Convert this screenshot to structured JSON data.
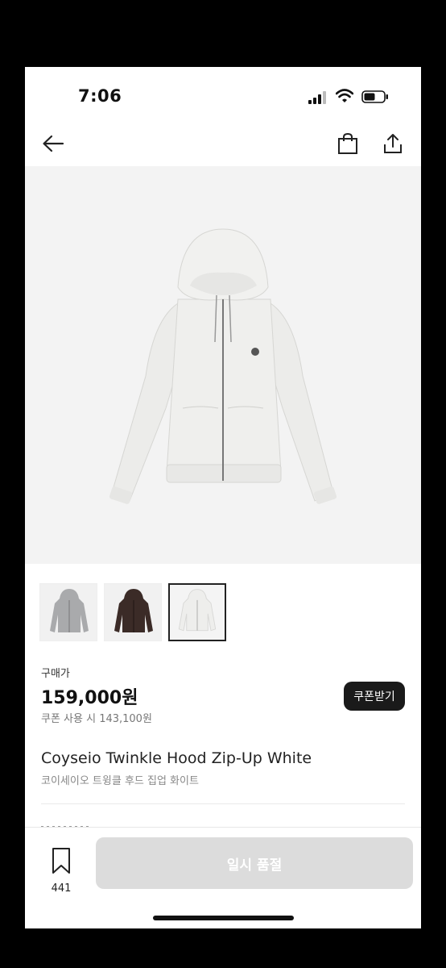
{
  "status_bar": {
    "time": "7:06"
  },
  "product": {
    "price_label": "구매가",
    "price": "159,000원",
    "coupon_price": "쿠폰 사용 시 143,100원",
    "coupon_button": "쿠폰받기",
    "name_en": "Coyseio Twinkle Hood Zip-Up White",
    "name_ko": "코이세이오 트윙클 후드 집업 화이트"
  },
  "thumbnails": [
    {
      "color": "gray",
      "swatch": "#a9aaac"
    },
    {
      "color": "brown",
      "swatch": "#3b2b27"
    },
    {
      "color": "white",
      "swatch": "#eeeeec"
    }
  ],
  "bottom_bar": {
    "wishlist_count": "441",
    "buy_button": "일시 품절"
  },
  "colors": {
    "coupon_button_bg": "#1a1a1a",
    "disabled_button_bg": "#dcdcdc",
    "hero_bg": "#f3f3f3"
  },
  "icons": [
    "back-arrow-icon",
    "shopping-bag-icon",
    "share-icon",
    "bookmark-icon"
  ]
}
